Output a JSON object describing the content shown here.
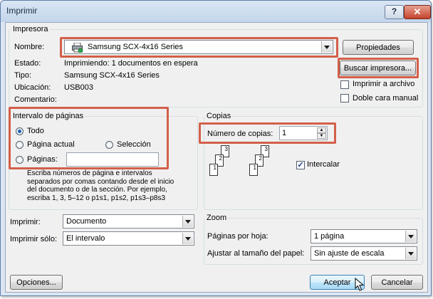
{
  "window": {
    "title": "Imprimir",
    "help_label": "?",
    "close_label": "✕"
  },
  "printer": {
    "group_title": "Impresora",
    "name_label": "Nombre:",
    "name_value": "Samsung SCX-4x16 Series",
    "status_label": "Estado:",
    "status_value": "Imprimiendo: 1 documentos en espera",
    "type_label": "Tipo:",
    "type_value": "Samsung SCX-4x16 Series",
    "location_label": "Ubicación:",
    "location_value": "USB003",
    "comment_label": "Comentario:",
    "properties_button": "Propiedades",
    "find_printer_button": "Buscar impresora...",
    "print_to_file_label": "Imprimir a archivo",
    "duplex_label": "Doble cara manual"
  },
  "page_range": {
    "group_title": "Intervalo de páginas",
    "all_label": "Todo",
    "current_page_label": "Página actual",
    "selection_label": "Selección",
    "pages_label": "Páginas:",
    "pages_value": "",
    "help_text": "Escriba números de página e intervalos separados por comas contando desde el inicio del documento o de la sección. Por ejemplo, escriba 1, 3, 5–12 o p1s1, p1s2, p1s3–p8s3"
  },
  "copies": {
    "group_title": "Copias",
    "number_label": "Número de copias:",
    "number_value": "1",
    "collate_label": "Intercalar",
    "collate_checked": true,
    "page_numbers": [
      "3",
      "2",
      "1"
    ]
  },
  "print_what": {
    "print_label": "Imprimir:",
    "print_value": "Documento",
    "print_only_label": "Imprimir sólo:",
    "print_only_value": "El intervalo"
  },
  "zoom": {
    "group_title": "Zoom",
    "pages_per_sheet_label": "Páginas por hoja:",
    "pages_per_sheet_value": "1 página",
    "scale_label": "Ajustar al tamaño del papel:",
    "scale_value": "Sin ajuste de escala"
  },
  "footer": {
    "options_button": "Opciones...",
    "ok_button": "Aceptar",
    "cancel_button": "Cancelar"
  },
  "colors": {
    "highlight": "#d35f4a",
    "radio_dot": "#1a5fb4"
  }
}
